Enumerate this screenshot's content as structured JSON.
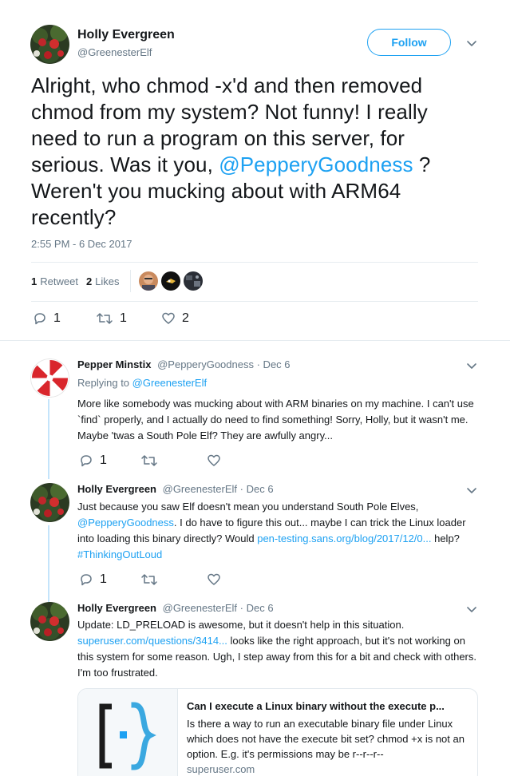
{
  "main": {
    "name": "Holly Evergreen",
    "handle": "@GreenesterElf",
    "follow_label": "Follow",
    "text_before": "Alright, who chmod -x'd and then removed chmod from my system? Not funny! I really need to run a program on this server, for serious. Was it you, ",
    "mention": "@PepperyGoodness",
    "text_after": " ? Weren't you mucking about with ARM64 recently?",
    "timestamp": "2:55 PM - 6 Dec 2017",
    "retweets_count": "1",
    "retweets_label": "Retweet",
    "likes_count": "2",
    "likes_label": "Likes",
    "reply_count": "1",
    "retweet_action_count": "1",
    "like_action_count": "2"
  },
  "replies": [
    {
      "name": "Pepper Minstix",
      "handle": "@PepperyGoodness",
      "date": "· Dec 6",
      "replying_to_prefix": "Replying to",
      "replying_to_handle": "@GreenesterElf",
      "text": "More like somebody was mucking about with ARM binaries on my machine. I can't use `find` properly, and I actually do need to find something! Sorry, Holly, but it wasn't me. Maybe 'twas a South Pole Elf? They are awfully angry...",
      "reply_count": "1"
    },
    {
      "name": "Holly Evergreen",
      "handle": "@GreenesterElf",
      "date": "· Dec 6",
      "text_1": "Just because you saw Elf doesn't mean you understand South Pole Elves, ",
      "mention": "@PepperyGoodness",
      "text_2": ". I do have to figure this out... maybe I can trick the Linux loader into loading this binary directly? Would ",
      "link": "pen-testing.sans.org/blog/2017/12/0...",
      "text_3": " help? ",
      "hashtag": "#ThinkingOutLoud",
      "reply_count": "1"
    },
    {
      "name": "Holly Evergreen",
      "handle": "@GreenesterElf",
      "date": "· Dec 6",
      "text_1": "Update: LD_PRELOAD is awesome, but it doesn't help in this situation. ",
      "link": "superuser.com/questions/3414...",
      "text_2": " looks like the right approach, but it's not working on this system for some reason. Ugh, I step away from this for a bit and check with others. I'm too frustrated."
    }
  ],
  "card": {
    "title": "Can I execute a Linux binary without the execute p...",
    "description": "Is there a way to run an executable binary file under Linux which does not have the execute bit set? chmod +x is not an option. E.g. it's permissions may be r--r--r--",
    "domain": "superuser.com"
  },
  "colors": {
    "link": "#1da1f2",
    "secondary_text": "#657786",
    "thread_line": "#c4e4fb"
  }
}
